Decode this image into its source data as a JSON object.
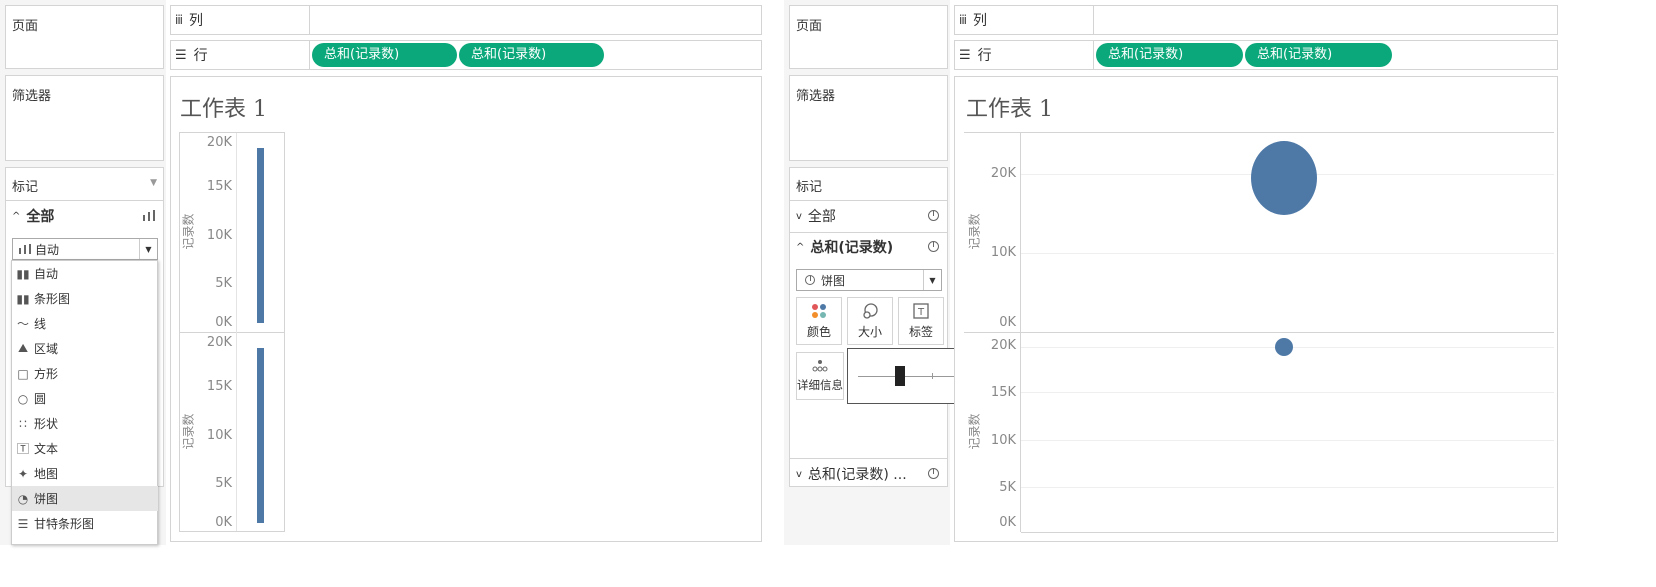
{
  "shared": {
    "pages_label": "页面",
    "filters_label": "筛选器",
    "marks_label": "标记",
    "columns_label": "列",
    "rows_label": "行",
    "pill_label": "总和(记录数)",
    "sheet_title": "工作表 1",
    "y_axis_label": "记录数"
  },
  "left": {
    "all_label": "全部",
    "mark_type_selected": "自动",
    "mark_types": [
      {
        "label": "自动",
        "icon": "bar-chart-icon"
      },
      {
        "label": "条形图",
        "icon": "bar-chart-icon"
      },
      {
        "label": "线",
        "icon": "line-icon"
      },
      {
        "label": "区域",
        "icon": "area-icon"
      },
      {
        "label": "方形",
        "icon": "square-icon"
      },
      {
        "label": "圆",
        "icon": "circle-icon"
      },
      {
        "label": "形状",
        "icon": "shapes-icon"
      },
      {
        "label": "文本",
        "icon": "text-icon"
      },
      {
        "label": "地图",
        "icon": "map-icon"
      },
      {
        "label": "饼图",
        "icon": "pie-icon",
        "highlighted": true
      },
      {
        "label": "甘特条形图",
        "icon": "gantt-icon"
      }
    ],
    "chart_ticks": [
      "20K",
      "15K",
      "10K",
      "5K",
      "0K"
    ]
  },
  "right": {
    "all_label": "全部",
    "measure_label": "总和(记录数)",
    "measure2_label": "总和(记录数) ...",
    "mark_type_selected": "饼图",
    "buttons": {
      "color": "颜色",
      "size": "大小",
      "label": "标签",
      "detail": "详细信息"
    },
    "size_slider_value": 0.28,
    "chart_ticks_top": [
      "20K",
      "10K",
      "0K"
    ],
    "chart_ticks_bottom": [
      "20K",
      "15K",
      "10K",
      "5K",
      "0K"
    ]
  },
  "colors": {
    "pill": "#0aa87a",
    "mark": "#4e79a7"
  },
  "chart_data": [
    {
      "type": "bar",
      "values": [
        19500
      ],
      "ylim": [
        0,
        20000
      ],
      "ylabel": "记录数"
    },
    {
      "type": "bar",
      "values": [
        19500
      ],
      "ylim": [
        0,
        20000
      ],
      "ylabel": "记录数"
    },
    {
      "type": "pie",
      "values": [
        19500
      ],
      "ylim": [
        0,
        24000
      ],
      "ylabel": "记录数"
    },
    {
      "type": "pie",
      "values": [
        19500
      ],
      "ylim": [
        0,
        20000
      ],
      "ylabel": "记录数"
    }
  ]
}
